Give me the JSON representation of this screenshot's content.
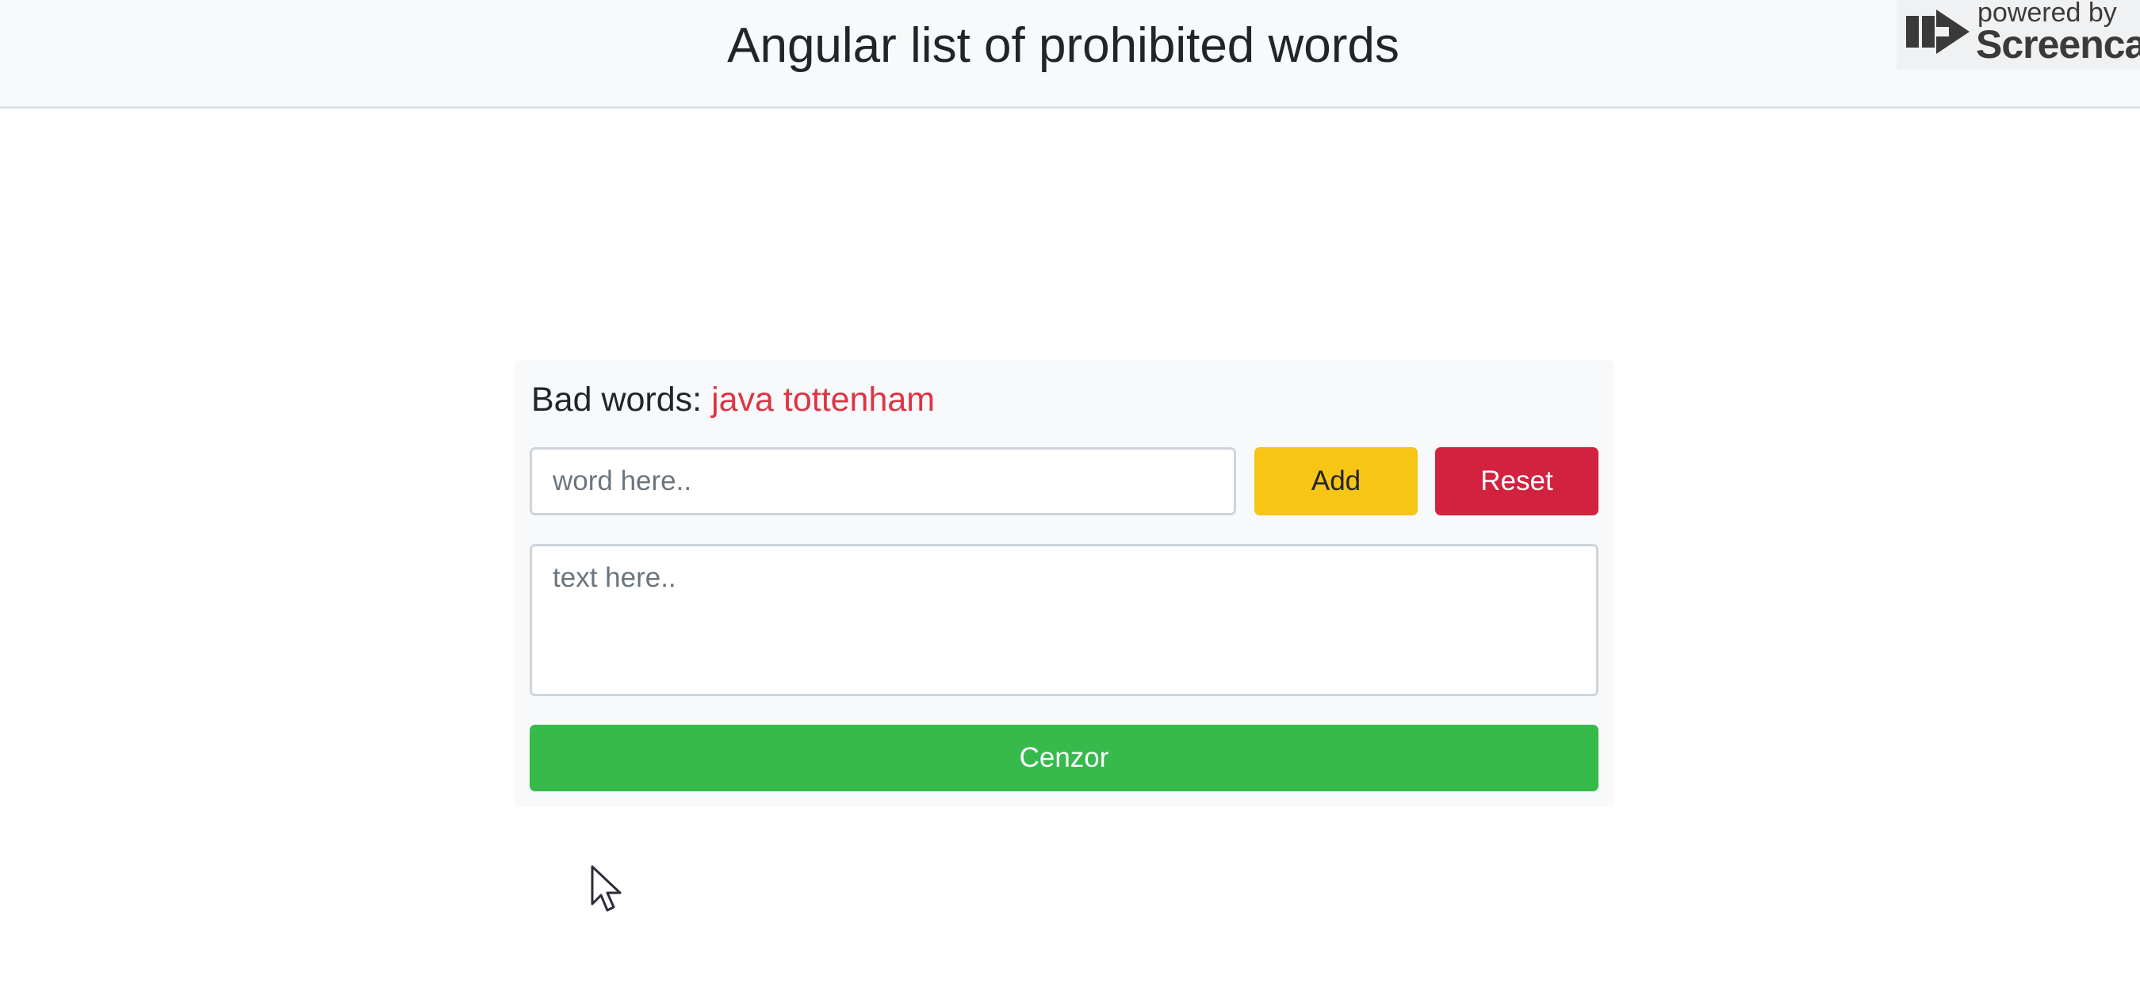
{
  "header": {
    "title": "Angular list of prohibited words"
  },
  "watermark": {
    "powered_by": "powered by",
    "brand": "Screencast",
    "icon": "screencast-logo-icon"
  },
  "card": {
    "bad_words_label": "Bad words:",
    "bad_words_list": "java tottenham",
    "word_input": {
      "placeholder": "word here..",
      "value": ""
    },
    "add_label": "Add",
    "reset_label": "Reset",
    "text_input": {
      "placeholder": "text here..",
      "value": ""
    },
    "cenzor_label": "Cenzor"
  },
  "colors": {
    "header_bg": "#f8f9fa",
    "card_bg": "#f8f9fa",
    "bad_words_accent": "#dc3545",
    "add_button": "#f7c516",
    "reset_button": "#d2223f",
    "cenzor_button": "#35ba4b"
  },
  "cursor": {
    "icon": "mouse-pointer-icon"
  }
}
